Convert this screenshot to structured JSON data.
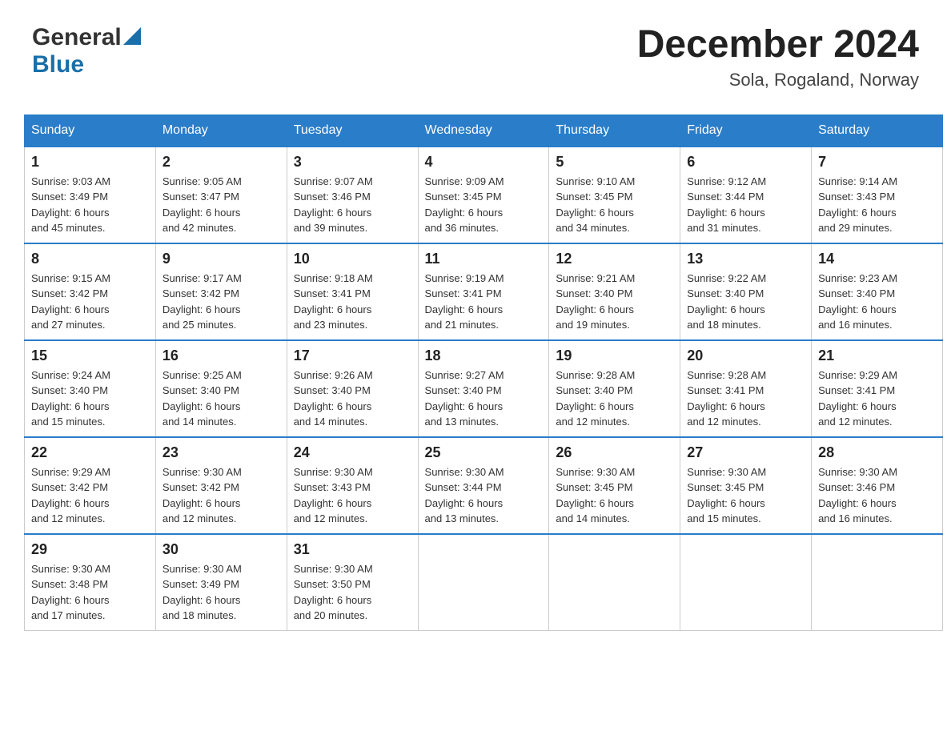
{
  "header": {
    "logo_general": "General",
    "logo_blue": "Blue",
    "month_title": "December 2024",
    "location": "Sola, Rogaland, Norway"
  },
  "weekdays": [
    "Sunday",
    "Monday",
    "Tuesday",
    "Wednesday",
    "Thursday",
    "Friday",
    "Saturday"
  ],
  "weeks": [
    [
      {
        "day": "1",
        "sunrise": "9:03 AM",
        "sunset": "3:49 PM",
        "daylight": "6 hours and 45 minutes."
      },
      {
        "day": "2",
        "sunrise": "9:05 AM",
        "sunset": "3:47 PM",
        "daylight": "6 hours and 42 minutes."
      },
      {
        "day": "3",
        "sunrise": "9:07 AM",
        "sunset": "3:46 PM",
        "daylight": "6 hours and 39 minutes."
      },
      {
        "day": "4",
        "sunrise": "9:09 AM",
        "sunset": "3:45 PM",
        "daylight": "6 hours and 36 minutes."
      },
      {
        "day": "5",
        "sunrise": "9:10 AM",
        "sunset": "3:45 PM",
        "daylight": "6 hours and 34 minutes."
      },
      {
        "day": "6",
        "sunrise": "9:12 AM",
        "sunset": "3:44 PM",
        "daylight": "6 hours and 31 minutes."
      },
      {
        "day": "7",
        "sunrise": "9:14 AM",
        "sunset": "3:43 PM",
        "daylight": "6 hours and 29 minutes."
      }
    ],
    [
      {
        "day": "8",
        "sunrise": "9:15 AM",
        "sunset": "3:42 PM",
        "daylight": "6 hours and 27 minutes."
      },
      {
        "day": "9",
        "sunrise": "9:17 AM",
        "sunset": "3:42 PM",
        "daylight": "6 hours and 25 minutes."
      },
      {
        "day": "10",
        "sunrise": "9:18 AM",
        "sunset": "3:41 PM",
        "daylight": "6 hours and 23 minutes."
      },
      {
        "day": "11",
        "sunrise": "9:19 AM",
        "sunset": "3:41 PM",
        "daylight": "6 hours and 21 minutes."
      },
      {
        "day": "12",
        "sunrise": "9:21 AM",
        "sunset": "3:40 PM",
        "daylight": "6 hours and 19 minutes."
      },
      {
        "day": "13",
        "sunrise": "9:22 AM",
        "sunset": "3:40 PM",
        "daylight": "6 hours and 18 minutes."
      },
      {
        "day": "14",
        "sunrise": "9:23 AM",
        "sunset": "3:40 PM",
        "daylight": "6 hours and 16 minutes."
      }
    ],
    [
      {
        "day": "15",
        "sunrise": "9:24 AM",
        "sunset": "3:40 PM",
        "daylight": "6 hours and 15 minutes."
      },
      {
        "day": "16",
        "sunrise": "9:25 AM",
        "sunset": "3:40 PM",
        "daylight": "6 hours and 14 minutes."
      },
      {
        "day": "17",
        "sunrise": "9:26 AM",
        "sunset": "3:40 PM",
        "daylight": "6 hours and 14 minutes."
      },
      {
        "day": "18",
        "sunrise": "9:27 AM",
        "sunset": "3:40 PM",
        "daylight": "6 hours and 13 minutes."
      },
      {
        "day": "19",
        "sunrise": "9:28 AM",
        "sunset": "3:40 PM",
        "daylight": "6 hours and 12 minutes."
      },
      {
        "day": "20",
        "sunrise": "9:28 AM",
        "sunset": "3:41 PM",
        "daylight": "6 hours and 12 minutes."
      },
      {
        "day": "21",
        "sunrise": "9:29 AM",
        "sunset": "3:41 PM",
        "daylight": "6 hours and 12 minutes."
      }
    ],
    [
      {
        "day": "22",
        "sunrise": "9:29 AM",
        "sunset": "3:42 PM",
        "daylight": "6 hours and 12 minutes."
      },
      {
        "day": "23",
        "sunrise": "9:30 AM",
        "sunset": "3:42 PM",
        "daylight": "6 hours and 12 minutes."
      },
      {
        "day": "24",
        "sunrise": "9:30 AM",
        "sunset": "3:43 PM",
        "daylight": "6 hours and 12 minutes."
      },
      {
        "day": "25",
        "sunrise": "9:30 AM",
        "sunset": "3:44 PM",
        "daylight": "6 hours and 13 minutes."
      },
      {
        "day": "26",
        "sunrise": "9:30 AM",
        "sunset": "3:45 PM",
        "daylight": "6 hours and 14 minutes."
      },
      {
        "day": "27",
        "sunrise": "9:30 AM",
        "sunset": "3:45 PM",
        "daylight": "6 hours and 15 minutes."
      },
      {
        "day": "28",
        "sunrise": "9:30 AM",
        "sunset": "3:46 PM",
        "daylight": "6 hours and 16 minutes."
      }
    ],
    [
      {
        "day": "29",
        "sunrise": "9:30 AM",
        "sunset": "3:48 PM",
        "daylight": "6 hours and 17 minutes."
      },
      {
        "day": "30",
        "sunrise": "9:30 AM",
        "sunset": "3:49 PM",
        "daylight": "6 hours and 18 minutes."
      },
      {
        "day": "31",
        "sunrise": "9:30 AM",
        "sunset": "3:50 PM",
        "daylight": "6 hours and 20 minutes."
      },
      null,
      null,
      null,
      null
    ]
  ]
}
